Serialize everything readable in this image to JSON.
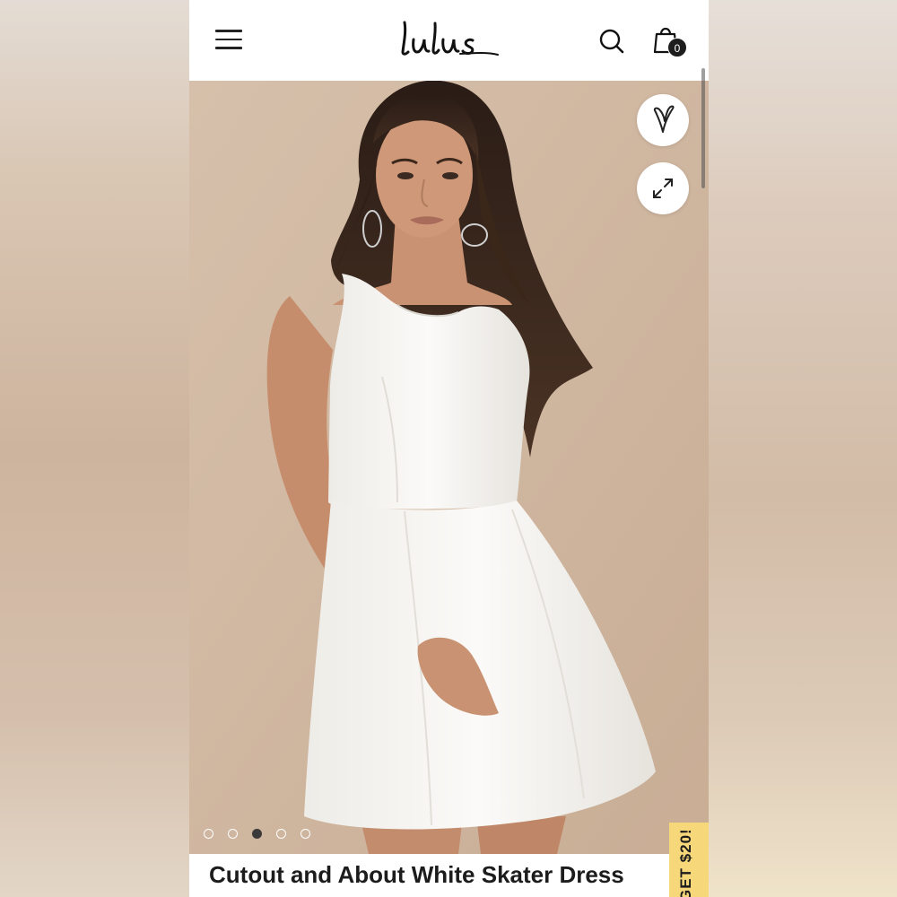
{
  "header": {
    "logo_text": "Lulus",
    "cart_count": "0"
  },
  "icons": {
    "menu": "hamburger-menu-icon",
    "search": "search-icon",
    "cart": "shopping-bag-icon",
    "favorite": "heart-icon",
    "zoom": "expand-icon"
  },
  "carousel": {
    "total": 5,
    "active_index": 2
  },
  "product": {
    "title": "Cutout and About White Skater Dress"
  },
  "promo": {
    "text": "GET $20!"
  },
  "colors": {
    "backdrop": "#d0b6a0",
    "promo": "#f6d77a",
    "dress": "#f7f6f3"
  }
}
